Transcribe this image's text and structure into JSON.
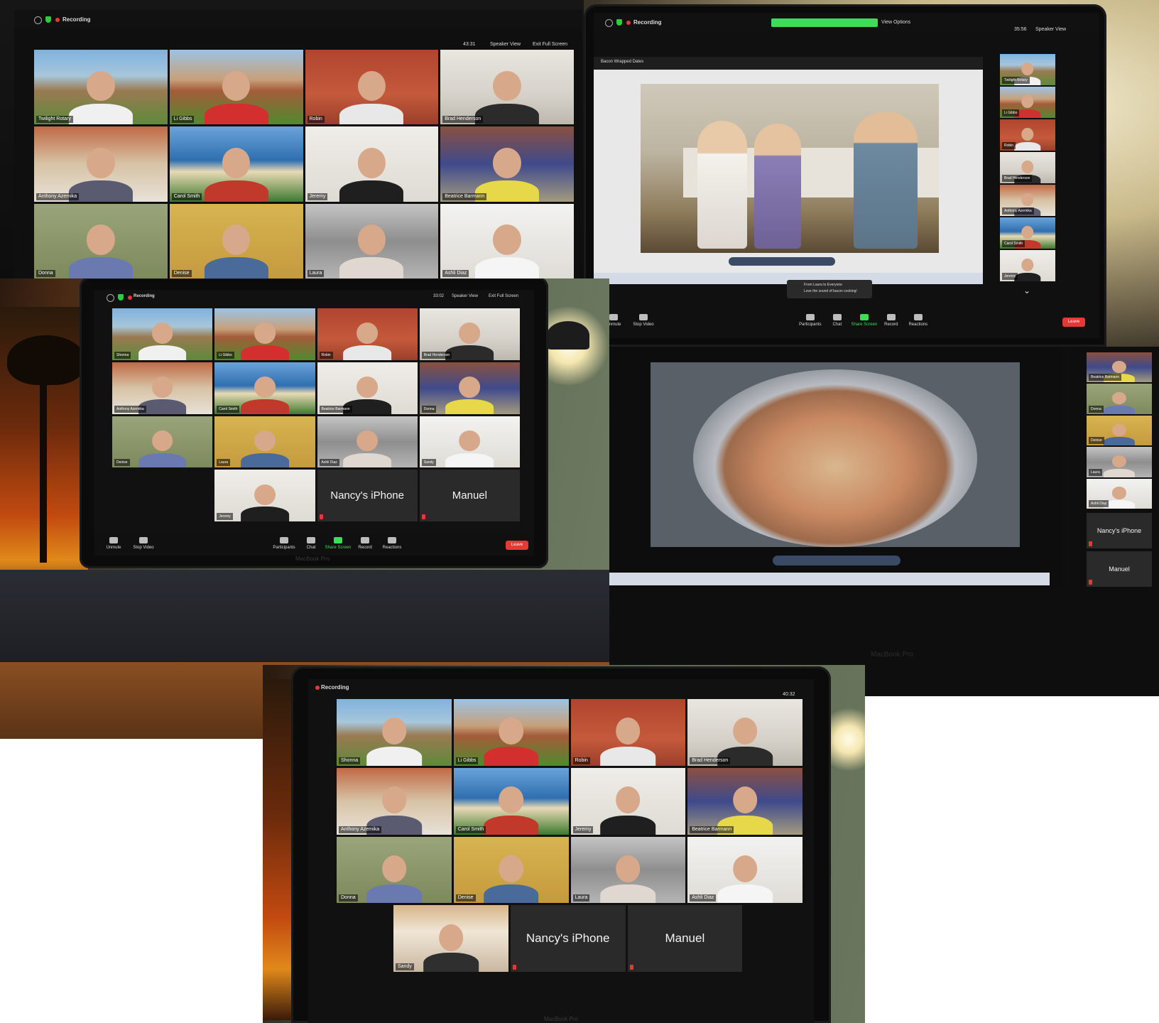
{
  "photo1": {
    "recording_label": "Recording",
    "timer": "43:31",
    "speaker_view_label": "Speaker View",
    "exit_full_screen_label": "Exit Full Screen",
    "tiles": [
      {
        "name": "Twilight Rotary"
      },
      {
        "name": "Li Gibbs"
      },
      {
        "name": "Robin"
      },
      {
        "name": "Brad Henderson"
      },
      {
        "name": "Anthony Azemika"
      },
      {
        "name": "Carol Smith"
      },
      {
        "name": "Jeremy"
      },
      {
        "name": "Beatrice Barmann"
      },
      {
        "name": "Donna"
      },
      {
        "name": "Denise"
      },
      {
        "name": "Laura"
      },
      {
        "name": "Ashli Diaz"
      }
    ]
  },
  "photo2": {
    "recording_label": "Recording",
    "timer": "35:56",
    "speaker_view_label": "Speaker View",
    "view_options_label": "View Options",
    "video_title": "Bacon Wrapped Dates",
    "chat_notice_from": "From Laura to Everyone",
    "chat_notice_text": "Love the sound of bacon cooking!",
    "toolbar": {
      "unmute": "Unmute",
      "stop_video": "Stop Video",
      "participants": "Participants",
      "chat": "Chat",
      "share_screen": "Share Screen",
      "record": "Record",
      "reactions": "Reactions",
      "leave": "Leave"
    },
    "thumbs": [
      {
        "name": "Twilight Rotary"
      },
      {
        "name": "Li Gibbs"
      },
      {
        "name": "Robin"
      },
      {
        "name": "Brad Henderson"
      },
      {
        "name": "Anthony Azemika"
      },
      {
        "name": "Carol Smith"
      },
      {
        "name": "Jeremy"
      }
    ]
  },
  "photo3": {
    "recording_label": "Recording",
    "timer": "33:02",
    "speaker_view_label": "Speaker View",
    "exit_full_screen_label": "Exit Full Screen",
    "brand": "MacBook Pro",
    "tiles": [
      {
        "name": "Shonna"
      },
      {
        "name": "Li Gibbs"
      },
      {
        "name": "Robin"
      },
      {
        "name": "Brad Henderson"
      },
      {
        "name": "Anthony Azemika"
      },
      {
        "name": "Carol Smith"
      },
      {
        "name": "Beatrice Barmann"
      },
      {
        "name": "Donna"
      },
      {
        "name": "Denise"
      },
      {
        "name": "Laura"
      },
      {
        "name": "Ashli Diaz"
      },
      {
        "name": "Sandy"
      },
      {
        "name": "Jeremy"
      }
    ],
    "text_tiles": [
      "Nancy's iPhone",
      "Manuel"
    ],
    "toolbar": {
      "unmute": "Unmute",
      "stop_video": "Stop Video",
      "participants": "Participants",
      "chat": "Chat",
      "share_screen": "Share Screen",
      "record": "Record",
      "reactions": "Reactions",
      "leave": "Leave"
    }
  },
  "photo4": {
    "brand": "MacBook Pro",
    "thumbs": [
      {
        "name": "Beatrice Barmann"
      },
      {
        "name": "Donna"
      },
      {
        "name": "Denise"
      },
      {
        "name": "Laura"
      },
      {
        "name": "Ashli Diaz"
      }
    ],
    "text_tiles": [
      "Nancy's iPhone",
      "Manuel"
    ]
  },
  "photo5": {
    "recording_label": "Recording",
    "timer": "40:32",
    "brand": "MacBook Pro",
    "tiles": [
      {
        "name": "Shonna"
      },
      {
        "name": "Li Gibbs"
      },
      {
        "name": "Robin"
      },
      {
        "name": "Brad Henderson"
      },
      {
        "name": "Anthony Azemika"
      },
      {
        "name": "Carol Smith"
      },
      {
        "name": "Jeremy"
      },
      {
        "name": "Beatrice Barmann"
      },
      {
        "name": "Donna"
      },
      {
        "name": "Denise"
      },
      {
        "name": "Laura"
      },
      {
        "name": "Ashli Diaz"
      },
      {
        "name": "Sandy"
      }
    ],
    "text_tiles": [
      "Nancy's iPhone",
      "Manuel"
    ]
  }
}
